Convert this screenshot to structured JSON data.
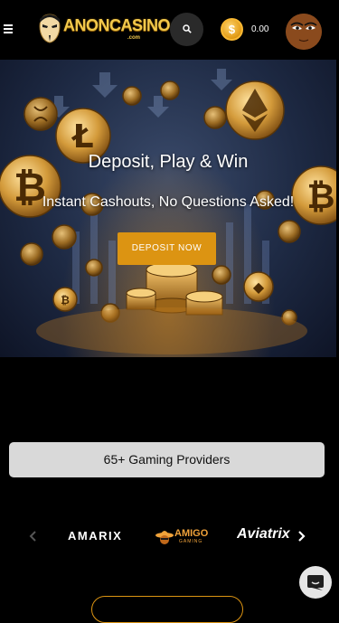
{
  "header": {
    "brand_name": "ANONCASINO",
    "brand_suffix": ".com",
    "balance": "0.00",
    "coin_symbol": "$",
    "icons": [
      "menu-icon",
      "search-icon",
      "coin-icon",
      "avatar"
    ]
  },
  "hero": {
    "title": "Deposit, Play & Win",
    "subtitle": "Instant Cashouts, No Questions Asked!",
    "cta_label": "DEPOSIT NOW"
  },
  "providers": {
    "heading": "65+ Gaming Providers",
    "logos": [
      {
        "name": "amarix",
        "text": "AMARIX"
      },
      {
        "name": "amigo-gaming",
        "text": "AMIGO",
        "sub": "GAMING"
      },
      {
        "name": "aviatrix",
        "text": "Aviatrix"
      }
    ]
  },
  "colors": {
    "accent": "#dc9412",
    "background": "#000000",
    "providers_bar": "#d9d9d9",
    "search_bg": "#2a2a2a"
  }
}
